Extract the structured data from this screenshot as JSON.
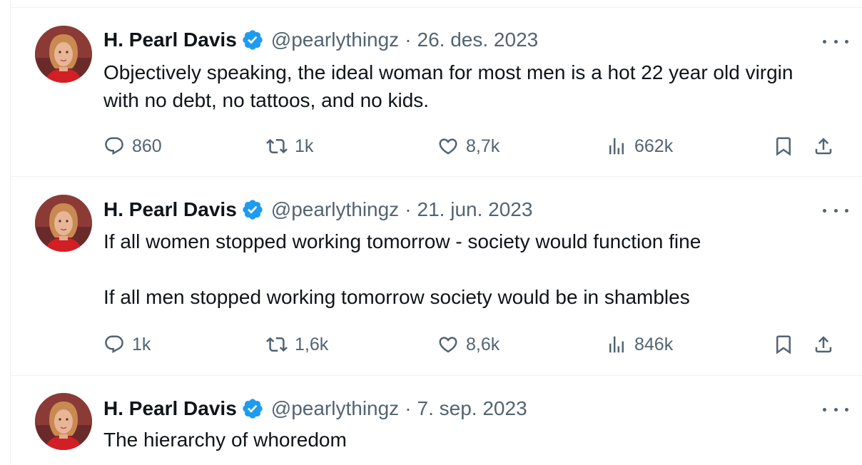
{
  "tweets": [
    {
      "author_name": "H. Pearl Davis",
      "handle": "@pearlythingz",
      "date": "26. des. 2023",
      "text": [
        "Objectively speaking, the ideal woman for most men is a hot 22 year old virgin with no debt, no tattoos, and no kids."
      ],
      "replies": "860",
      "retweets": "1k",
      "likes": "8,7k",
      "views": "662k"
    },
    {
      "author_name": "H. Pearl Davis",
      "handle": "@pearlythingz",
      "date": "21. jun. 2023",
      "text": [
        "If all women stopped working tomorrow - society would function fine",
        "",
        "If all men stopped working tomorrow society would be in shambles"
      ],
      "replies": "1k",
      "retweets": "1,6k",
      "likes": "8,6k",
      "views": "846k"
    },
    {
      "author_name": "H. Pearl Davis",
      "handle": "@pearlythingz",
      "date": "7. sep. 2023",
      "text": [
        "The hierarchy of whoredom"
      ]
    }
  ],
  "separator": "·",
  "colors": {
    "verified": "#1d9bf0",
    "muted": "#536471",
    "text": "#0f1419",
    "border": "#eff3f4"
  },
  "icons": [
    "verified-badge-icon",
    "more-icon",
    "reply-icon",
    "retweet-icon",
    "like-icon",
    "views-icon",
    "bookmark-icon",
    "share-icon"
  ]
}
